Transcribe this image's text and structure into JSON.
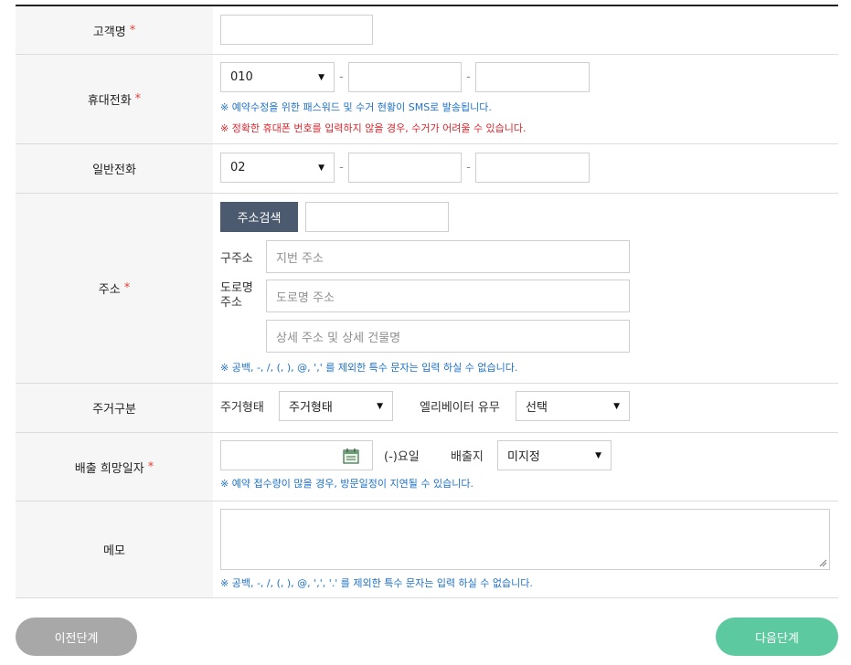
{
  "rows": {
    "name": {
      "label": "고객명",
      "required": "*",
      "value": ""
    },
    "mobile": {
      "label": "휴대전화",
      "required": "*",
      "prefix": "010",
      "dash": "-",
      "mid": "",
      "last": "",
      "note1": "※ 예약수정을 위한 패스워드 및 수거 현황이 SMS로 발송됩니다.",
      "note2": "※ 정확한 휴대폰 번호를 입력하지 않을 경우, 수거가 어려울 수 있습니다."
    },
    "phone": {
      "label": "일반전화",
      "prefix": "02",
      "dash": "-",
      "mid": "",
      "last": ""
    },
    "address": {
      "label": "주소",
      "required": "*",
      "search_button": "주소검색",
      "zip": "",
      "jibun_label": "구주소",
      "jibun_placeholder": "지번 주소",
      "road_label_1": "도로명",
      "road_label_2": "주소",
      "road_placeholder": "도로명 주소",
      "detail_placeholder": "상세 주소 및 상세 건물명",
      "note": "※ 공백, -, /, (, ), @, ',' 를 제외한 특수 문자는 입력 하실 수 없습니다."
    },
    "residence": {
      "label": "주거구분",
      "type_label": "주거형태",
      "type_value": "주거형태",
      "elevator_label": "엘리베이터 유무",
      "elevator_value": "선택"
    },
    "date": {
      "label": "배출 희망일자",
      "required": "*",
      "value": "",
      "weekday": "(-)요일",
      "place_label": "배출지",
      "place_value": "미지정",
      "note": "※ 예약 접수량이 많을 경우, 방문일정이 지연될 수 있습니다."
    },
    "memo": {
      "label": "메모",
      "value": "",
      "note": "※ 공백, -, /, (, ), @, ',', '.' 를 제외한 특수 문자는 입력 하실 수 없습니다."
    }
  },
  "buttons": {
    "prev": "이전단계",
    "next": "다음단계"
  },
  "colors": {
    "accent_green": "#5cc9a0",
    "gray_button": "#a8a8a8",
    "search_button": "#4b5a6e",
    "note_blue": "#1e72c8",
    "note_red": "#d8262d"
  },
  "icons": {
    "select_arrow": "triangle-down",
    "calendar": "calendar-icon",
    "resize": "resize-handle-icon"
  }
}
